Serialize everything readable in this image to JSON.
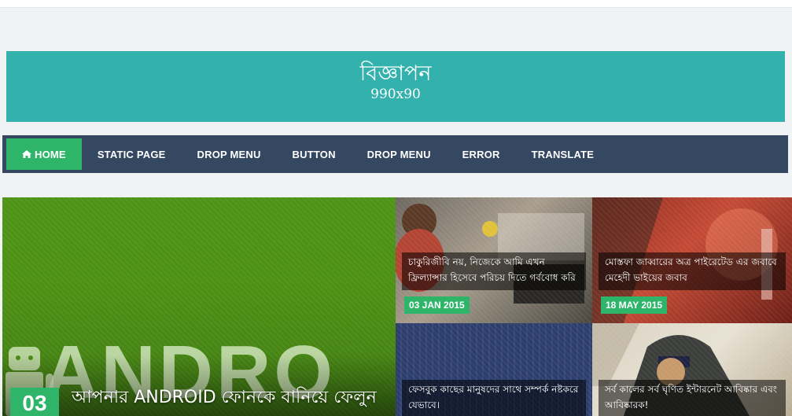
{
  "ad": {
    "title": "বিজ্ঞাপন",
    "size": "990x90"
  },
  "nav": {
    "items": [
      {
        "label": "HOME",
        "icon": "home-icon"
      },
      {
        "label": "STATIC PAGE"
      },
      {
        "label": "DROP MENU"
      },
      {
        "label": "BUTTON"
      },
      {
        "label": "DROP MENU"
      },
      {
        "label": "ERROR"
      },
      {
        "label": "TRANSLATE"
      }
    ]
  },
  "featured": {
    "main": {
      "number": "03",
      "title": "আপনার ANDROID ফোনকে বানিয়ে ফেলুন",
      "image_text": "ANDRO"
    },
    "posts": [
      {
        "title": "চাকুরিজীবি নয়, নিজেকে আমি এখন ফ্রিল্যান্সার হিসেবে পরিচয় দিতে গর্ববোধ করি",
        "date": "03 JAN 2015"
      },
      {
        "title": "মোস্তফা জাব্বারের অত্র পাইরেটেড এর জবাবে মেহেদী ভাইয়ের জবাব",
        "date": "18 MAY 2015"
      },
      {
        "title": "ফেসবুক কাছের মানুষদের সাথে সম্পর্ক নষ্টকরে যেভাবে।",
        "date": ""
      },
      {
        "title": "সর্ব কালের সর্ব ঘৃণিত ইন্টারনেট আবিষ্কার এবং আবিষ্কারক!",
        "date": ""
      }
    ]
  },
  "colors": {
    "accent": "#2fb56a",
    "nav_bg": "#344861",
    "ad_bg": "#33b1ac"
  }
}
